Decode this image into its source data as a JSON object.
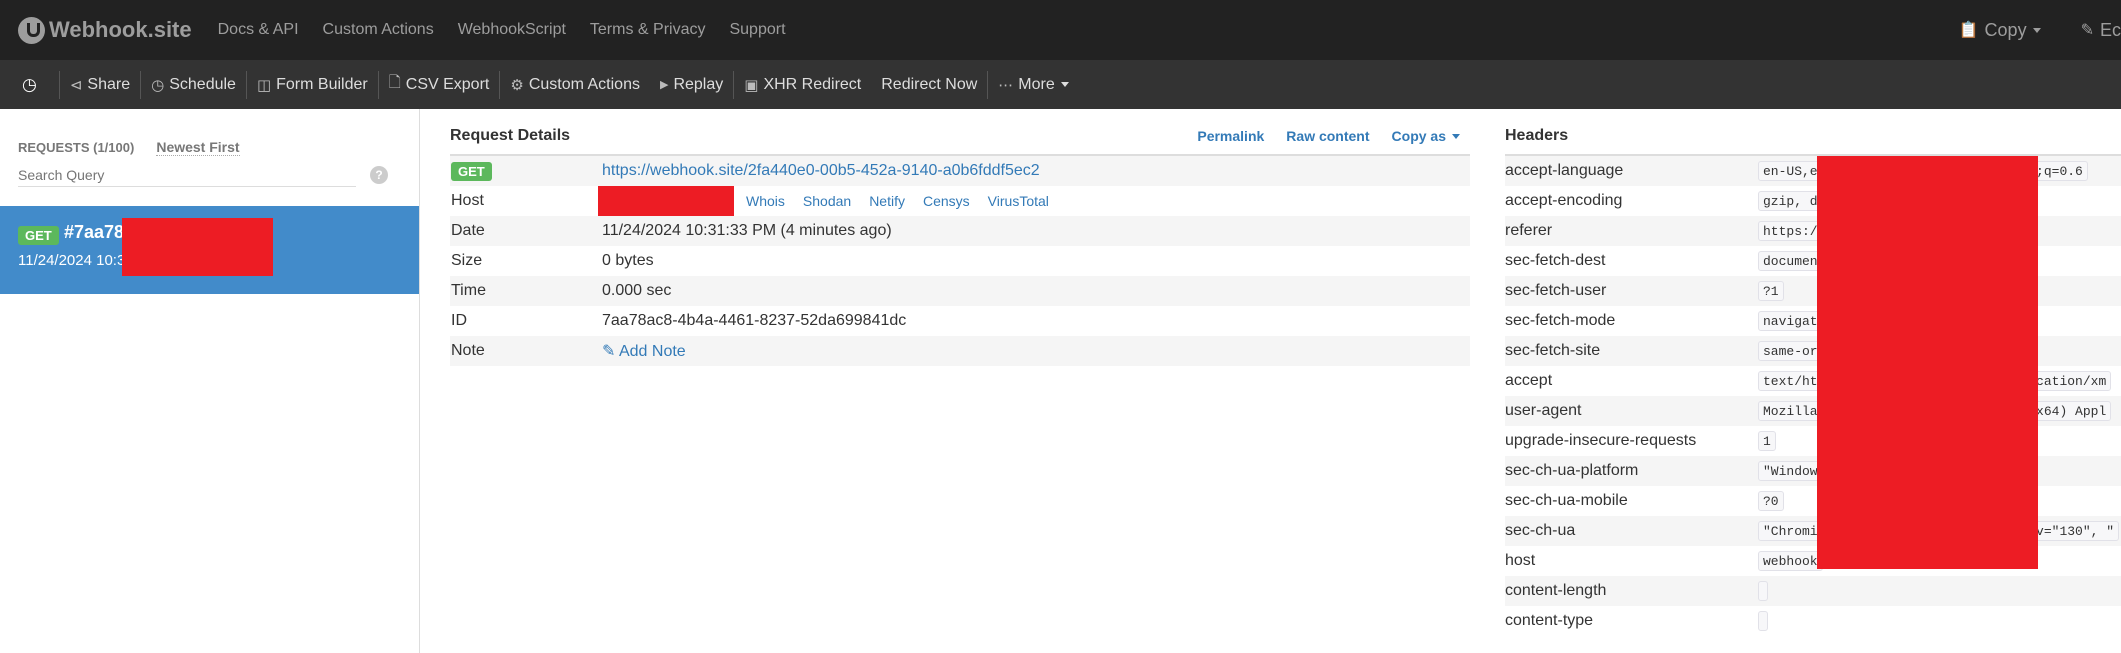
{
  "topbar": {
    "brand": "Webhook.site",
    "nav": [
      "Docs & API",
      "Custom Actions",
      "WebhookScript",
      "Terms & Privacy",
      "Support"
    ],
    "copy_label": "Copy",
    "edit_label": "Ec"
  },
  "toolbar": {
    "share": "Share",
    "schedule": "Schedule",
    "form_builder": "Form Builder",
    "csv_export": "CSV Export",
    "custom_actions": "Custom Actions",
    "replay": "Replay",
    "xhr_redirect": "XHR Redirect",
    "redirect_now": "Redirect Now",
    "more": "More"
  },
  "sidebar": {
    "requests_label": "REQUESTS (1/100)",
    "sort_label": "Newest First",
    "search_placeholder": "Search Query",
    "help": "?",
    "request": {
      "method": "GET",
      "id": "#7aa78",
      "date": "11/24/2024 10:3"
    }
  },
  "details": {
    "title": "Request Details",
    "permalink": "Permalink",
    "raw_content": "Raw content",
    "copy_as": "Copy as",
    "method": "GET",
    "url": "https://webhook.site/2fa440e0-00b5-452a-9140-a0b6fddf5ec2",
    "host_label": "Host",
    "host_links": [
      "Whois",
      "Shodan",
      "Netify",
      "Censys",
      "VirusTotal"
    ],
    "date_label": "Date",
    "date": "11/24/2024 10:31:33 PM (4 minutes ago)",
    "size_label": "Size",
    "size": "0 bytes",
    "time_label": "Time",
    "time": "0.000 sec",
    "id_label": "ID",
    "id": "7aa78ac8-4b4a-4461-8237-52da699841dc",
    "note_label": "Note",
    "add_note": "Add Note"
  },
  "headers": {
    "title": "Headers",
    "rows": [
      {
        "key": "accept-language",
        "value": "en-US,e                          fr;q=0.6"
      },
      {
        "key": "accept-encoding",
        "value": "gzip, d"
      },
      {
        "key": "referer",
        "value": "https:/"
      },
      {
        "key": "sec-fetch-dest",
        "value": "document"
      },
      {
        "key": "sec-fetch-user",
        "value": "?1"
      },
      {
        "key": "sec-fetch-mode",
        "value": "navigate"
      },
      {
        "key": "sec-fetch-site",
        "value": "same-or"
      },
      {
        "key": "accept",
        "value": "text/ht                           ication/xm"
      },
      {
        "key": "user-agent",
        "value": "Mozilla                            x64) Appl"
      },
      {
        "key": "upgrade-insecure-requests",
        "value": "1"
      },
      {
        "key": "sec-ch-ua-platform",
        "value": "\"Windows"
      },
      {
        "key": "sec-ch-ua-mobile",
        "value": "?0"
      },
      {
        "key": "sec-ch-ua",
        "value": "\"Chromi                            v=\"130\", \""
      },
      {
        "key": "host",
        "value": "webhook"
      },
      {
        "key": "content-length",
        "value": ""
      },
      {
        "key": "content-type",
        "value": ""
      }
    ]
  },
  "colors": {
    "navbar": "#222222",
    "toolbar": "#333333",
    "selected_request": "#428bca",
    "method_badge": "#5cb85c",
    "link": "#337ab7",
    "redaction": "#ed1c24"
  }
}
